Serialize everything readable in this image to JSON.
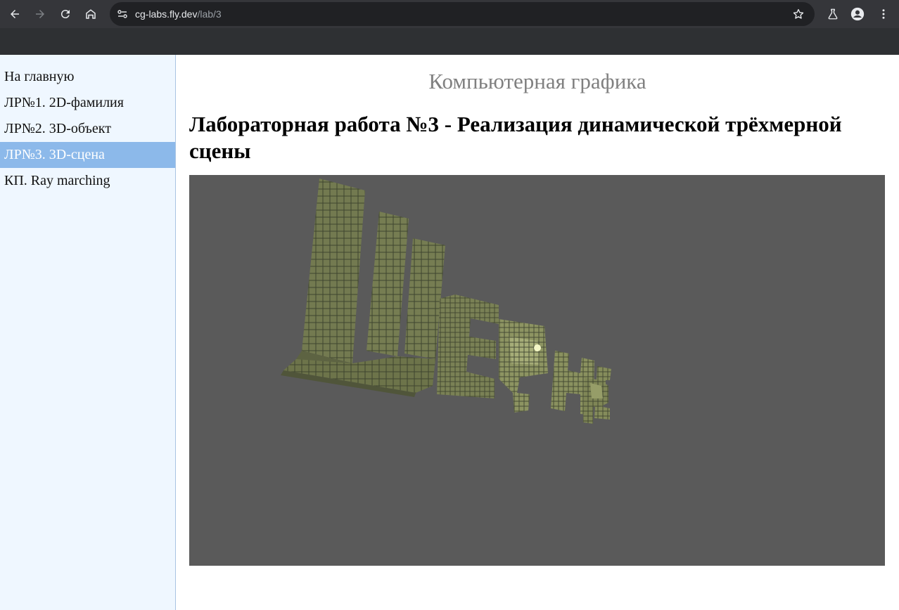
{
  "browser": {
    "url_host": "cg-labs.fly.dev",
    "url_path": "/lab/3"
  },
  "sidebar": {
    "items": [
      {
        "label": "На главную",
        "active": false
      },
      {
        "label": "ЛР№1. 2D-фамилия",
        "active": false
      },
      {
        "label": "ЛР№2. 3D-объект",
        "active": false
      },
      {
        "label": "ЛР№3. 3D-сцена",
        "active": true
      },
      {
        "label": "КП. Ray marching",
        "active": false
      }
    ]
  },
  "main": {
    "site_title": "Компьютерная графика",
    "lab_title": "Лабораторная работа №3 - Реализация динамической трёхмерной сцены"
  },
  "scene": {
    "background": "#5a5a5a",
    "object_color": "#7c8256",
    "object_highlight": "#a9ae7a",
    "light_color": "#f4f7c6"
  }
}
